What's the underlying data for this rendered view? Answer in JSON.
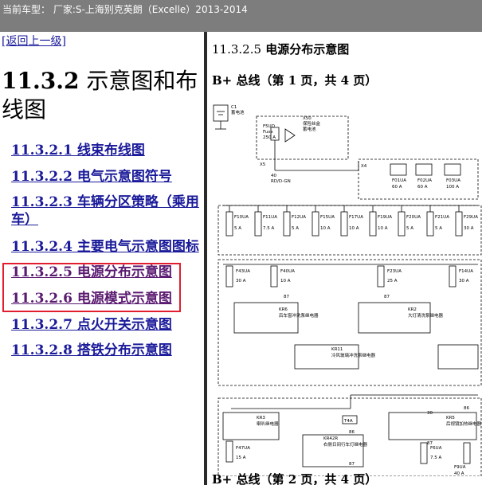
{
  "header": {
    "vehicle_label": "当前车型：  厂家:S-上海别克英朗（Excelle）2013-2014"
  },
  "nav": {
    "back_link": "[返回上一级]",
    "section_number": "11.3.2",
    "section_title": " 示意图和布线图"
  },
  "toc": [
    {
      "label": "11.3.2.1 线束布线图"
    },
    {
      "label": "11.3.2.2 电气示意图符号"
    },
    {
      "label": "11.3.2.3 车辆分区策略（乘用车）"
    },
    {
      "label": "11.3.2.4 主要电气示意图图标"
    },
    {
      "label": "11.3.2.5 电源分布示意图"
    },
    {
      "label": "11.3.2.6 电源模式示意图"
    },
    {
      "label": "11.3.2.7 点火开关示意图"
    },
    {
      "label": "11.3.2.8 搭铁分布示意图"
    }
  ],
  "content": {
    "heading_number": "11.3.2.5",
    "heading_title": " 电源分布示意图",
    "page1_label": "B+ 总线（第 1 页，共 4 页）",
    "page2_label": "B+ 总线（第 2 页，共 4 页）"
  },
  "diagram": {
    "battery": "C1\n蓄电池",
    "x50": "X50\n保险丝盒\n蓄电池",
    "f5ud": "F5UD\nFuse\n250 A",
    "x5": "X5",
    "wire": "40\nRD/D-GN",
    "x4": "X4",
    "fuses_row1": [
      {
        "name": "F01UA",
        "amp": "60 A"
      },
      {
        "name": "F02UA",
        "amp": "60 A"
      },
      {
        "name": "F03UA",
        "amp": "100 A"
      }
    ],
    "fuses_row2": [
      {
        "name": "F10UA",
        "amp": "5 A"
      },
      {
        "name": "F11UA",
        "amp": "7.5 A"
      },
      {
        "name": "F12UA",
        "amp": "5 A"
      },
      {
        "name": "F15UA",
        "amp": "10 A"
      },
      {
        "name": "F17UA",
        "amp": "10 A"
      },
      {
        "name": "F19UA",
        "amp": "10 A"
      },
      {
        "name": "F20UA",
        "amp": "5 A"
      },
      {
        "name": "F21UA",
        "amp": "5 A"
      },
      {
        "name": "F29UA",
        "amp": "30 A"
      }
    ],
    "fuses_row3": [
      {
        "name": "F43UA",
        "amp": "30 A"
      },
      {
        "name": "F40UA",
        "amp": "10 A"
      },
      {
        "name": "F23UA",
        "amp": "25 A"
      },
      {
        "name": "F14UA",
        "amp": "30 A"
      }
    ],
    "relays": [
      {
        "name": "KR6",
        "desc": "后车窗冲洗泵继电器"
      },
      {
        "name": "KR2",
        "desc": "大灯清洗泵继电器"
      },
      {
        "name": "KR11",
        "desc": "冷风玻璃冲洗泵继电器"
      },
      {
        "name": "KR3",
        "desc": "喇叭继电器"
      },
      {
        "name": "KR42R",
        "desc": "右侧日间行车灯继电器"
      },
      {
        "name": "KR5",
        "desc": "后视镜加热继电器"
      }
    ],
    "terminals": [
      "87",
      "87",
      "86",
      "87",
      "30",
      "87",
      "86"
    ],
    "t4a": "T4A",
    "fuses_row4": [
      {
        "name": "F47UA",
        "amp": "15 A"
      },
      {
        "name": "F6UA",
        "amp": "7.5 A"
      },
      {
        "name": "F9UA",
        "amp": "40 A"
      }
    ]
  }
}
